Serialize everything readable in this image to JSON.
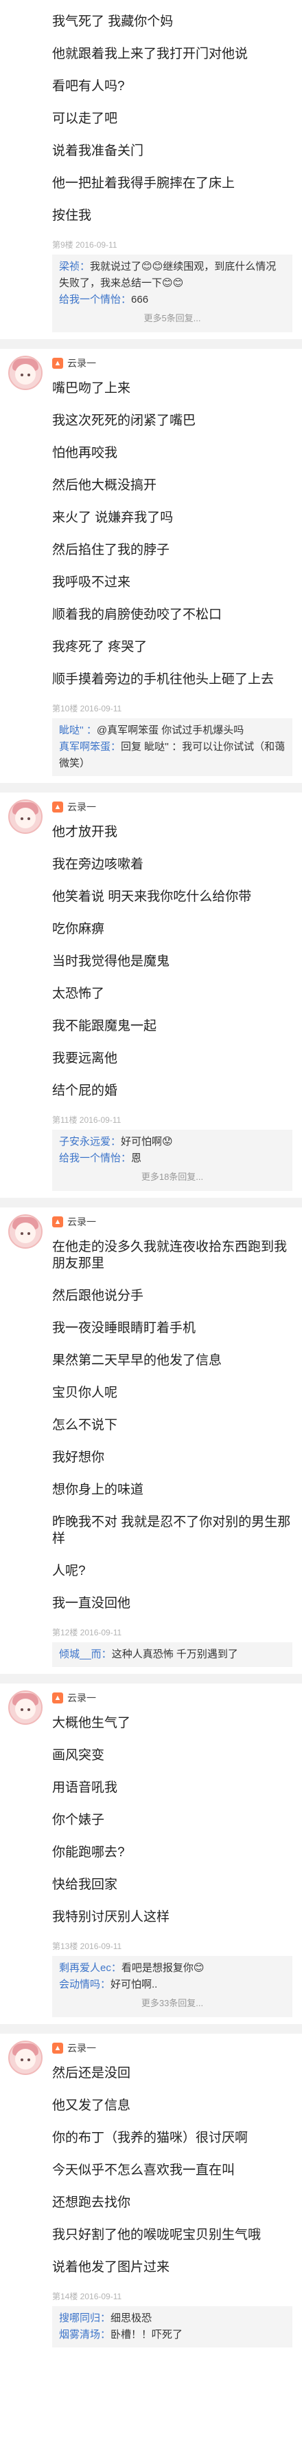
{
  "posts": [
    {
      "user": "",
      "lines": [
        "我气死了 我藏你个妈",
        "他就跟着我上来了我打开门对他说",
        "看吧有人吗?",
        "可以走了吧",
        "说着我准备关门",
        "他一把扯着我得手腕摔在了床上",
        "按住我"
      ],
      "floor": "第9楼 2016-09-11",
      "replies": [
        {
          "name": "梁祯",
          "text": "我就说过了😊😊继续围观，到底什么情况失败了，我来总结一下😊😊"
        },
        {
          "name": "给我一个情怡",
          "text": "666"
        }
      ],
      "more": "更多5条回复..."
    },
    {
      "user": "云录一",
      "lines": [
        "嘴巴吻了上来",
        "我这次死死的闭紧了嘴巴",
        "怕他再咬我",
        "然后他大概没搞开",
        "来火了 说嫌弃我了吗",
        "然后掐住了我的脖子",
        "我呼吸不过来",
        "顺着我的肩膀使劲咬了不松口",
        "我疼死了 疼哭了",
        "顺手摸着旁边的手机往他头上砸了上去"
      ],
      "floor": "第10楼 2016-09-11",
      "replies": [
        {
          "name": "眦哒'' ",
          "text": "@真军啊笨蛋 你试过手机爆头吗"
        },
        {
          "name": "真军啊笨蛋",
          "text": "回复 眦哒'' ：我可以让你试试（和蔼微笑）"
        }
      ],
      "more": ""
    },
    {
      "user": "云录一",
      "lines": [
        "他才放开我",
        "我在旁边咳嗽着",
        "他笑着说 明天来我你吃什么给你带",
        "吃你麻痹",
        "当时我觉得他是魔鬼",
        "太恐怖了",
        "我不能跟魔鬼一起",
        "我要远离他",
        "结个屁的婚"
      ],
      "floor": "第11楼 2016-09-11",
      "replies": [
        {
          "name": "子安永远爱",
          "text": "好可怕啊😟"
        },
        {
          "name": "给我一个情怡",
          "text": "恩"
        }
      ],
      "more": "更多18条回复..."
    },
    {
      "user": "云录一",
      "lines": [
        "在他走的没多久我就连夜收拾东西跑到我朋友那里",
        "然后跟他说分手",
        "我一夜没睡眼睛盯着手机",
        "果然第二天早早的他发了信息",
        "宝贝你人呢",
        "怎么不说下",
        "我好想你",
        "想你身上的味道",
        "昨晚我不对 我就是忍不了你对别的男生那样",
        "人呢?",
        "我一直没回他"
      ],
      "floor": "第12楼 2016-09-11",
      "replies": [
        {
          "name": "倾城__而",
          "text": "这种人真恐怖 千万别遇到了"
        }
      ],
      "more": ""
    },
    {
      "user": "云录一",
      "lines": [
        "大概他生气了",
        "画风突变",
        "用语音吼我",
        "你个婊子",
        "你能跑哪去?",
        "快给我回家",
        "我特别讨厌别人这样"
      ],
      "floor": "第13楼 2016-09-11",
      "replies": [
        {
          "name": "剩再爱人ec",
          "text": "看吧是想报复你😊"
        },
        {
          "name": "会动情吗",
          "text": "好可怕啊.."
        }
      ],
      "more": "更多33条回复..."
    },
    {
      "user": "云录一",
      "lines": [
        "然后还是没回",
        "他又发了信息",
        "你的布丁（我养的猫咪）很讨厌啊",
        "今天似乎不怎么喜欢我一直在叫",
        "还想跑去找你",
        "我只好割了他的喉咙呢宝贝别生气哦",
        "说着他发了图片过来"
      ],
      "floor": "第14楼 2016-09-11",
      "replies": [
        {
          "name": "搜哪同归",
          "text": "细思极恐"
        },
        {
          "name": "烟雾清场",
          "text": "卧槽！！吓死了"
        }
      ],
      "more": ""
    }
  ]
}
